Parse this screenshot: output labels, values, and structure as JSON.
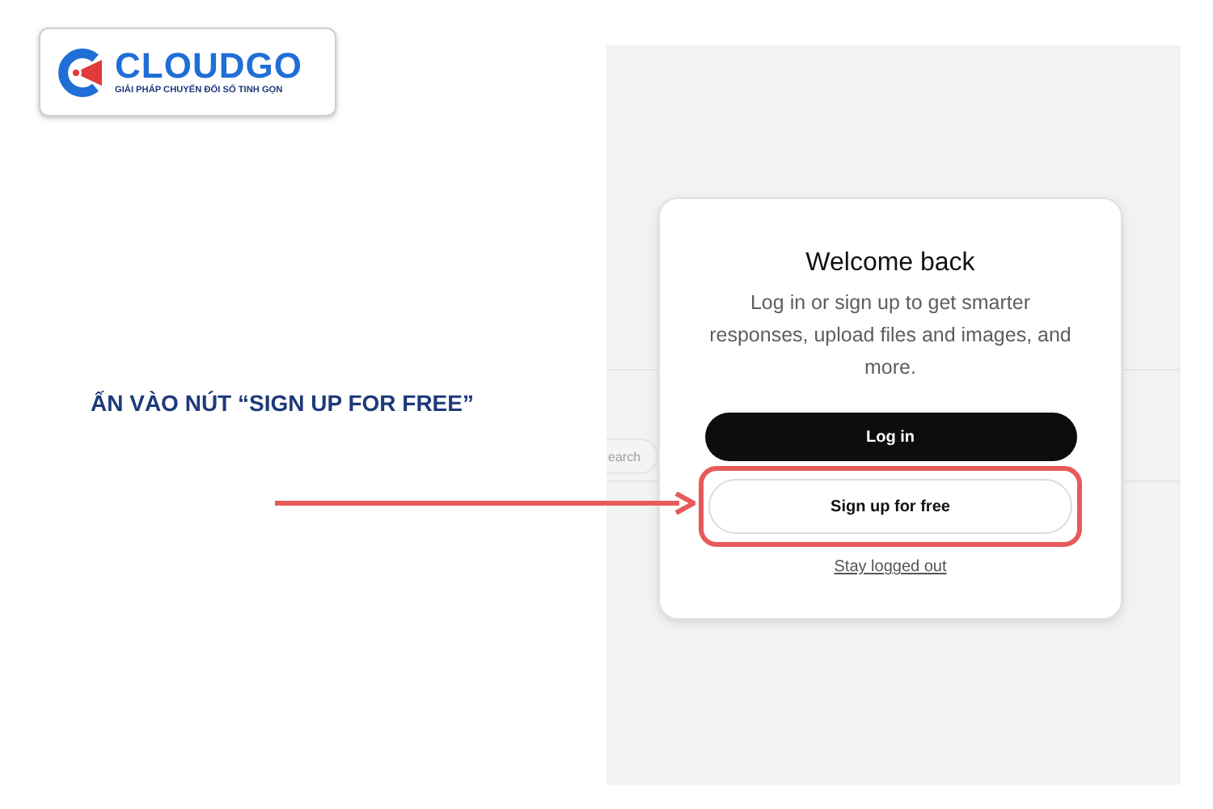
{
  "logo": {
    "name": "CLOUDGO",
    "tagline": "GIẢI PHÁP CHUYỂN ĐỔI SỐ TINH GỌN"
  },
  "instruction": "ẤN VÀO NÚT “SIGN UP FOR FREE”",
  "screenshot": {
    "search_field": {
      "placeholder": "earch"
    },
    "dialog": {
      "title": "Welcome back",
      "message": "Log in or sign up to get smarter responses, upload files and images, and more.",
      "buttons": [
        {
          "label": "Log in",
          "kind": "primary",
          "highlighted": false
        },
        {
          "label": "Sign up for free",
          "kind": "secondary",
          "highlighted": true
        }
      ],
      "link": "Stay logged out"
    }
  }
}
